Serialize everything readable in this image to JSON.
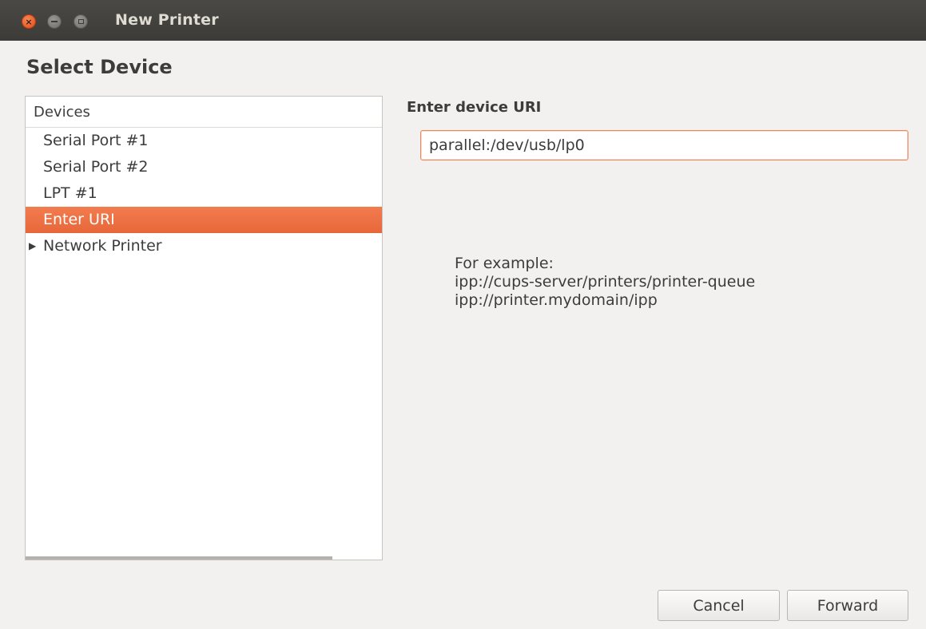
{
  "window": {
    "title": "New Printer"
  },
  "page": {
    "title": "Select Device"
  },
  "devices": {
    "header": "Devices",
    "items": [
      {
        "label": "Serial Port #1"
      },
      {
        "label": "Serial Port #2"
      },
      {
        "label": "LPT #1"
      },
      {
        "label": "Enter URI",
        "selected": true
      },
      {
        "label": "Network Printer",
        "expandable": true
      }
    ]
  },
  "uri": {
    "label": "Enter device URI",
    "value": "parallel:/dev/usb/lp0",
    "example_heading": "For example:",
    "examples": [
      "ipp://cups-server/printers/printer-queue",
      "ipp://printer.mydomain/ipp"
    ]
  },
  "buttons": {
    "cancel": "Cancel",
    "forward": "Forward"
  },
  "colors": {
    "accent": "#f07746",
    "titlebar": "#3c3b37",
    "background": "#f2f1f0"
  },
  "icons": {
    "close": "close-icon",
    "minimize": "minimize-icon",
    "maximize": "maximize-icon",
    "expander": "triangle-right-icon"
  }
}
